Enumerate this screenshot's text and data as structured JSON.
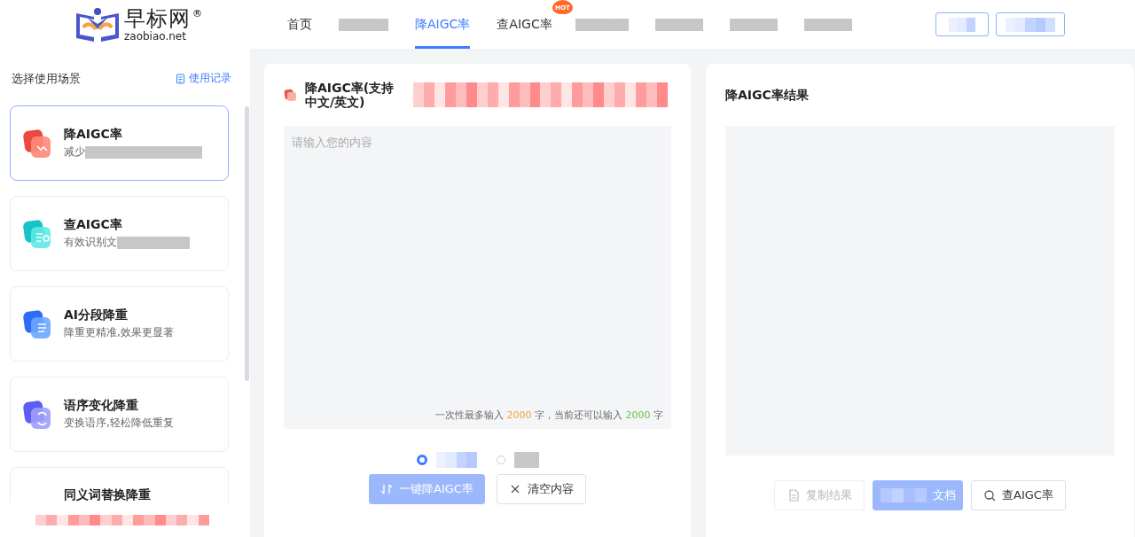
{
  "logo": {
    "name": "早标网",
    "domain": "zaobiao.net",
    "mark": "®"
  },
  "nav": [
    {
      "kind": "text",
      "label": "首页",
      "selected": false
    },
    {
      "kind": "blurred",
      "selected": false
    },
    {
      "kind": "text",
      "label": "降AIGC率",
      "selected": true
    },
    {
      "kind": "text",
      "label": "查AIGC率",
      "selected": false,
      "badge": "HOT"
    },
    {
      "kind": "blurred",
      "selected": false
    },
    {
      "kind": "blurred",
      "selected": false
    },
    {
      "kind": "blurred",
      "selected": false
    },
    {
      "kind": "blurred",
      "selected": false
    }
  ],
  "account_buttons": [
    {
      "kind": "blurred"
    },
    {
      "kind": "blurred"
    }
  ],
  "sidebar": {
    "title": "选择使用场景",
    "history_link": "使用记录",
    "items": [
      {
        "title": "降AIGC率",
        "desc": "减少",
        "desc_blurred": true,
        "selected": true
      },
      {
        "title": "查AIGC率",
        "desc": "有效识别文",
        "desc_blurred": true,
        "selected": false
      },
      {
        "title": "AI分段降重",
        "desc": "降重更精准,效果更显著",
        "desc_blurred": false,
        "selected": false
      },
      {
        "title": "语序变化降重",
        "desc": "变换语序,轻松降低重复",
        "desc_blurred": false,
        "selected": false
      },
      {
        "title": "同义词替换降重",
        "selected": false
      }
    ],
    "footer_blurred": true
  },
  "input_panel": {
    "title": "降AIGC率(支持中文/英文)",
    "title_note_blurred": true,
    "placeholder": "请输入您的内容",
    "limit_note": {
      "before": "一次性最多输入 ",
      "max": "2000",
      "middle": " 字，当前还可以输入 ",
      "remaining": "2000",
      "after": " 字"
    },
    "modes": [
      {
        "selected": true
      },
      {
        "selected": false
      }
    ],
    "buttons": [
      {
        "kind": "primary",
        "label": "一键降AIGC率"
      },
      {
        "kind": "outline",
        "label": "清空内容"
      }
    ]
  },
  "result_panel": {
    "title": "降AIGC率结果",
    "buttons": [
      {
        "kind": "disabled",
        "label": "复制结果",
        "label_blurred": false
      },
      {
        "kind": "primary",
        "label": "文档",
        "label_blurred": true
      },
      {
        "kind": "outline",
        "label": "查AIGC率",
        "label_blurred": false
      }
    ]
  }
}
